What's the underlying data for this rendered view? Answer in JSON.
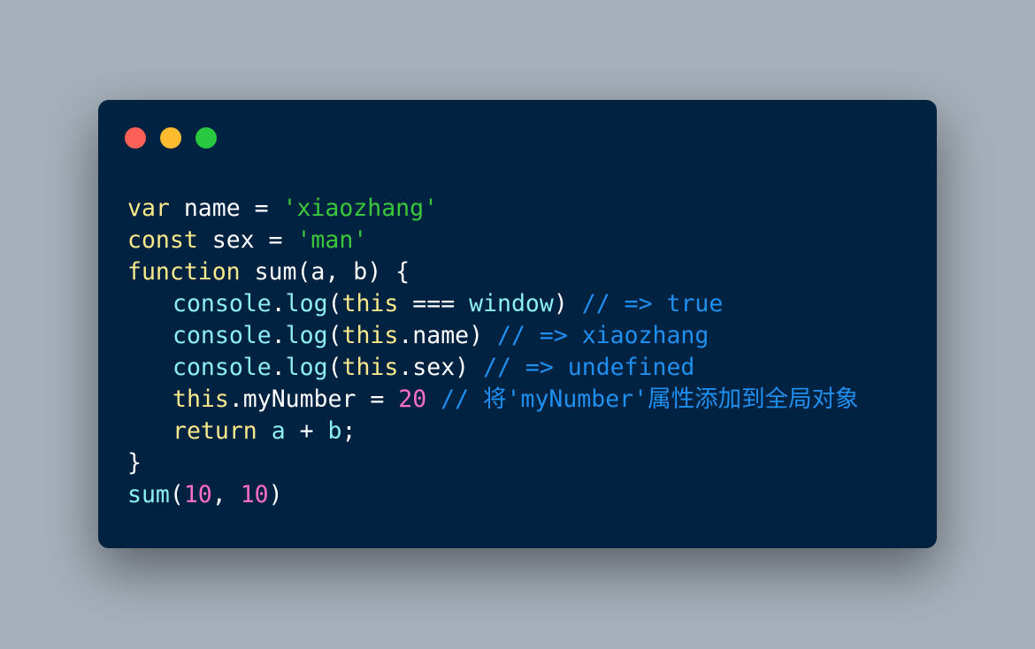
{
  "window": {
    "background": "#012241",
    "dots": [
      {
        "name": "close-dot",
        "color": "#fe5f57"
      },
      {
        "name": "minimize-dot",
        "color": "#febc2e"
      },
      {
        "name": "maximize-dot",
        "color": "#28c840"
      }
    ]
  },
  "colors": {
    "plain": "#ffffff",
    "keyword": "#f9e98b",
    "string": "#3ac83a",
    "number": "#ff6ec7",
    "method": "#8df0f0",
    "comment": "#1f8ff0"
  },
  "code": {
    "lines": [
      {
        "indent": 0,
        "tokens": [
          {
            "t": "var",
            "k": "keyword"
          },
          {
            "t": " name = ",
            "k": "plain"
          },
          {
            "t": "'xiaozhang'",
            "k": "string"
          }
        ]
      },
      {
        "indent": 0,
        "tokens": [
          {
            "t": "const",
            "k": "keyword"
          },
          {
            "t": " sex = ",
            "k": "plain"
          },
          {
            "t": "'man'",
            "k": "string"
          }
        ]
      },
      {
        "indent": 0,
        "tokens": [
          {
            "t": "function",
            "k": "keyword"
          },
          {
            "t": " sum(a, b) {",
            "k": "plain"
          }
        ]
      },
      {
        "indent": 1,
        "tokens": [
          {
            "t": "console",
            "k": "method"
          },
          {
            "t": ".",
            "k": "plain"
          },
          {
            "t": "log",
            "k": "method"
          },
          {
            "t": "(",
            "k": "plain"
          },
          {
            "t": "this",
            "k": "keyword"
          },
          {
            "t": " === ",
            "k": "plain"
          },
          {
            "t": "window",
            "k": "method"
          },
          {
            "t": ") ",
            "k": "plain"
          },
          {
            "t": "// => true",
            "k": "comment"
          }
        ]
      },
      {
        "indent": 1,
        "tokens": [
          {
            "t": "console",
            "k": "method"
          },
          {
            "t": ".",
            "k": "plain"
          },
          {
            "t": "log",
            "k": "method"
          },
          {
            "t": "(",
            "k": "plain"
          },
          {
            "t": "this",
            "k": "keyword"
          },
          {
            "t": ".name) ",
            "k": "plain"
          },
          {
            "t": "// => xiaozhang",
            "k": "comment"
          }
        ]
      },
      {
        "indent": 1,
        "tokens": [
          {
            "t": "console",
            "k": "method"
          },
          {
            "t": ".",
            "k": "plain"
          },
          {
            "t": "log",
            "k": "method"
          },
          {
            "t": "(",
            "k": "plain"
          },
          {
            "t": "this",
            "k": "keyword"
          },
          {
            "t": ".sex) ",
            "k": "plain"
          },
          {
            "t": "// => undefined",
            "k": "comment"
          }
        ]
      },
      {
        "indent": 1,
        "tokens": [
          {
            "t": "this",
            "k": "keyword"
          },
          {
            "t": ".myNumber = ",
            "k": "plain"
          },
          {
            "t": "20",
            "k": "number"
          },
          {
            "t": " ",
            "k": "plain"
          },
          {
            "t": "// 将'myNumber'属性添加到全局对象",
            "k": "comment"
          }
        ]
      },
      {
        "indent": 1,
        "tokens": [
          {
            "t": "return",
            "k": "keyword"
          },
          {
            "t": " ",
            "k": "plain"
          },
          {
            "t": "a",
            "k": "method"
          },
          {
            "t": " + ",
            "k": "plain"
          },
          {
            "t": "b",
            "k": "method"
          },
          {
            "t": ";",
            "k": "plain"
          }
        ]
      },
      {
        "indent": 0,
        "tokens": [
          {
            "t": "}",
            "k": "plain"
          }
        ]
      },
      {
        "indent": 0,
        "tokens": [
          {
            "t": "sum",
            "k": "method"
          },
          {
            "t": "(",
            "k": "plain"
          },
          {
            "t": "10",
            "k": "number"
          },
          {
            "t": ", ",
            "k": "plain"
          },
          {
            "t": "10",
            "k": "number"
          },
          {
            "t": ")",
            "k": "plain"
          }
        ]
      }
    ]
  }
}
